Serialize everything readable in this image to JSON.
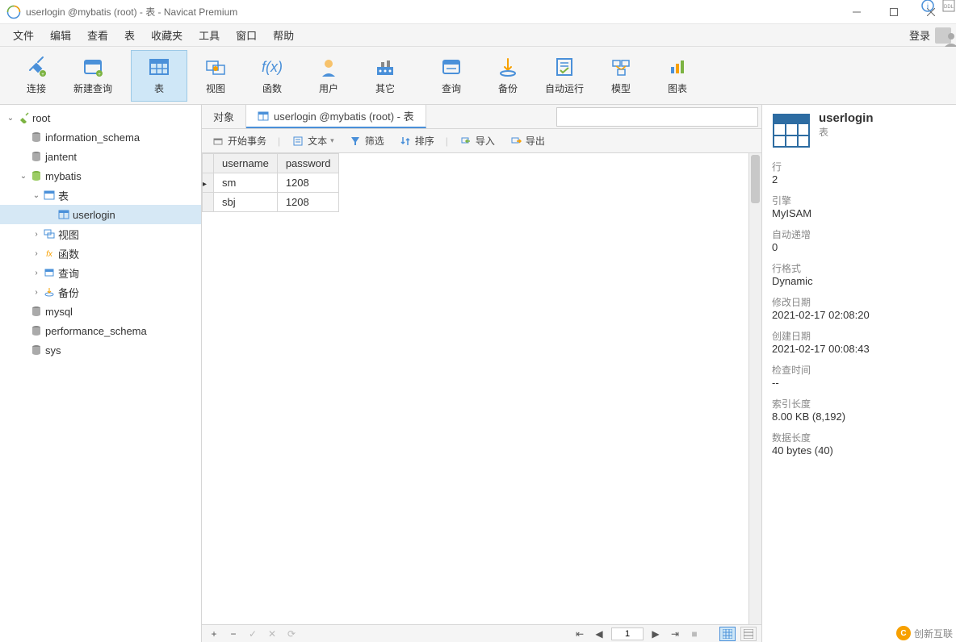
{
  "window": {
    "title": "userlogin @mybatis (root) - 表 - Navicat Premium"
  },
  "menu": {
    "file": "文件",
    "edit": "编辑",
    "view": "查看",
    "table": "表",
    "fav": "收藏夹",
    "tools": "工具",
    "window": "窗口",
    "help": "帮助",
    "login": "登录"
  },
  "toolbar": {
    "connect": "连接",
    "newquery": "新建查询",
    "table": "表",
    "view": "视图",
    "function": "函数",
    "user": "用户",
    "other": "其它",
    "query": "查询",
    "backup": "备份",
    "autorun": "自动运行",
    "model": "模型",
    "chart": "图表"
  },
  "tree": {
    "root": "root",
    "dbs": {
      "info": "information_schema",
      "jantent": "jantent",
      "mybatis": "mybatis",
      "mysql": "mysql",
      "perf": "performance_schema",
      "sys": "sys"
    },
    "mybatis_children": {
      "tables": "表",
      "userlogin": "userlogin",
      "views": "视图",
      "functions": "函数",
      "queries": "查询",
      "backups": "备份"
    }
  },
  "tabs": {
    "objects": "对象",
    "userlogin": "userlogin @mybatis (root) - 表"
  },
  "subtoolbar": {
    "begintx": "开始事务",
    "text": "文本",
    "filter": "筛选",
    "sort": "排序",
    "import": "导入",
    "export": "导出"
  },
  "grid": {
    "cols": {
      "username": "username",
      "password": "password"
    },
    "rows": [
      {
        "username": "sm",
        "password": "1208"
      },
      {
        "username": "sbj",
        "password": "1208"
      }
    ]
  },
  "pager": {
    "page": "1"
  },
  "info": {
    "name": "userlogin",
    "type": "表",
    "props": {
      "rows_k": "行",
      "rows_v": "2",
      "engine_k": "引擎",
      "engine_v": "MyISAM",
      "ai_k": "自动递增",
      "ai_v": "0",
      "rowfmt_k": "行格式",
      "rowfmt_v": "Dynamic",
      "mod_k": "修改日期",
      "mod_v": "2021-02-17 02:08:20",
      "create_k": "创建日期",
      "create_v": "2021-02-17 00:08:43",
      "check_k": "检查时间",
      "check_v": "--",
      "idxlen_k": "索引长度",
      "idxlen_v": "8.00 KB (8,192)",
      "datalen_k": "数据长度",
      "datalen_v": "40 bytes (40)"
    }
  },
  "watermark": "创新互联"
}
